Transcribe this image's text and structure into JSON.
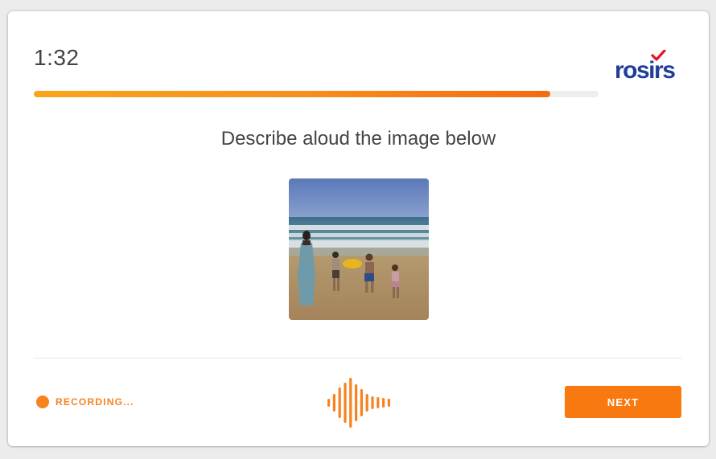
{
  "timer": {
    "value": "1:32"
  },
  "logo": {
    "text": "rosirs",
    "primary_color": "#1f3e99",
    "check_color": "#e3161f",
    "check_icon": "checkmark-icon"
  },
  "progress": {
    "fraction": 0.915,
    "colors": [
      "#f9a51b",
      "#f46b12"
    ]
  },
  "prompt": {
    "text": "Describe aloud the image below"
  },
  "image": {
    "subject": "beach-family-photo"
  },
  "recording": {
    "label": "RECORDING...",
    "color": "#f7821e",
    "icon": "recording-dot-icon"
  },
  "waveform": {
    "icon": "audio-waveform-icon",
    "color": "#f7821e"
  },
  "next_button": {
    "label": "NEXT",
    "color": "#f7790f"
  }
}
